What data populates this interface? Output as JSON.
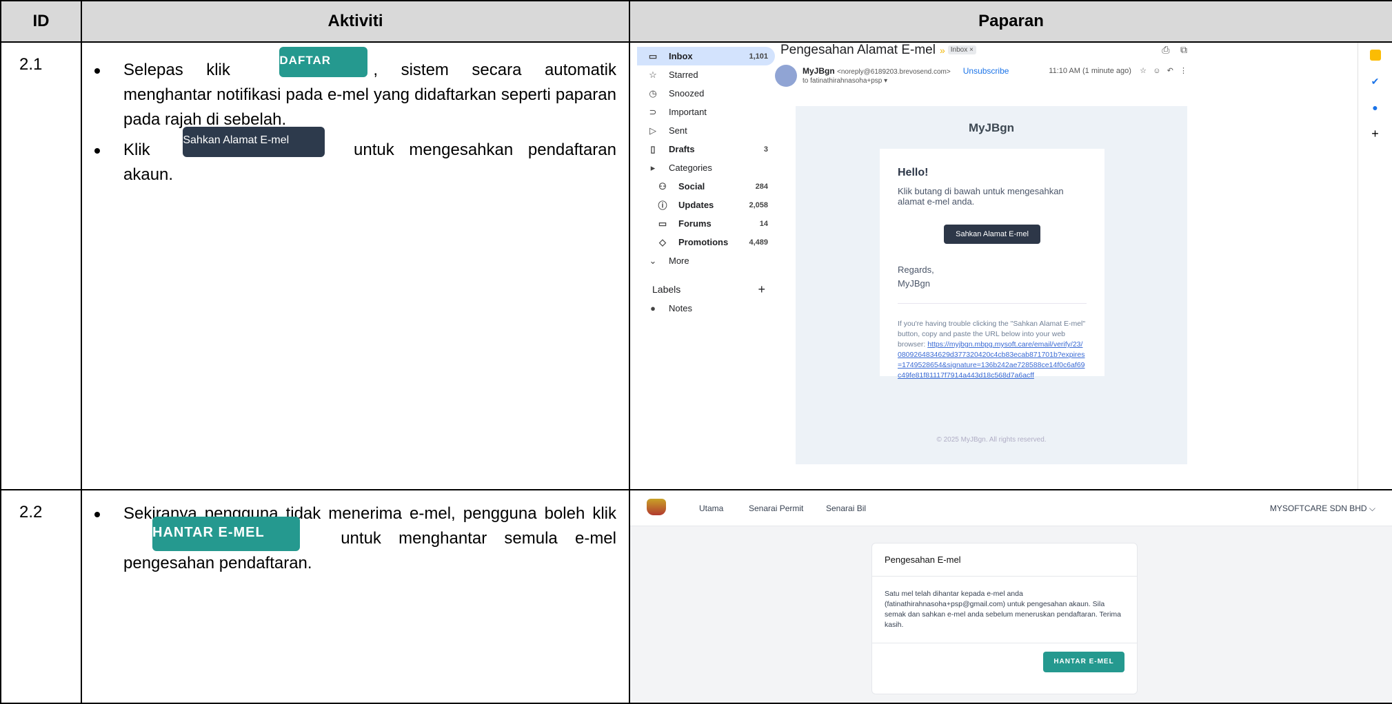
{
  "header": {
    "id": "ID",
    "activity": "Aktiviti",
    "display": "Paparan"
  },
  "rows": [
    {
      "id": "2.1",
      "bullet1_pre": "Selepas klik",
      "daftar_button": "DAFTAR",
      "bullet1_post": ", sistem secara automatik menghantar notifikasi pada e-mel yang didaftarkan seperti paparan pada rajah di sebelah.",
      "bullet2_pre": "Klik",
      "sahkan_button": "Sahkan Alamat E-mel",
      "bullet2_post": " untuk mengesahkan pendaftaran akaun."
    },
    {
      "id": "2.2",
      "bullet1_pre": "Sekiranya pengguna tidak menerima e-mel, pengguna boleh klik",
      "hantar_button": "HANTAR E-MEL",
      "bullet1_post": " untuk menghantar semula e-mel pengesahan pendaftaran."
    }
  ],
  "gmail": {
    "sidebar": [
      {
        "icon": "▭",
        "label": "Inbox",
        "count": "1,101",
        "selected": true
      },
      {
        "icon": "☆",
        "label": "Starred",
        "count": ""
      },
      {
        "icon": "◷",
        "label": "Snoozed",
        "count": ""
      },
      {
        "icon": "⊃",
        "label": "Important",
        "count": ""
      },
      {
        "icon": "▷",
        "label": "Sent",
        "count": ""
      },
      {
        "icon": "▯",
        "label": "Drafts",
        "count": "3"
      },
      {
        "icon": "▸",
        "label": "Categories",
        "count": ""
      },
      {
        "icon": "⚇",
        "label": "Social",
        "count": "284"
      },
      {
        "icon": "ⓘ",
        "label": "Updates",
        "count": "2,058"
      },
      {
        "icon": "▭",
        "label": "Forums",
        "count": "14"
      },
      {
        "icon": "◇",
        "label": "Promotions",
        "count": "4,489"
      },
      {
        "icon": "⌄",
        "label": "More",
        "count": ""
      }
    ],
    "labels_heading": "Labels",
    "labels_add": "+",
    "notes_label": "Notes",
    "subject": "Pengesahan Alamat E-mel",
    "inbox_tag": "Inbox ×",
    "sender_name": "MyJBgn",
    "sender_addr": "<noreply@6189203.brevosend.com>",
    "unsubscribe": "Unsubscribe",
    "to": "to fatinathirahnasoha+psp ▾",
    "time": "11:10 AM (1 minute ago)",
    "brand": "MyJBgn",
    "hello": "Hello!",
    "message": "Klik butang di bawah untuk mengesahkan alamat e-mel anda.",
    "button": "Sahkan Alamat E-mel",
    "regards": "Regards,",
    "signoff": "MyJBgn",
    "trouble": "If you're having trouble clicking the \"Sahkan Alamat E-mel\" button, copy and paste the URL below into your web browser: ",
    "url": "https://myjbgn.mbpg.mysoft.care/email/verify/23/0809264834629d377320420c4cb83ecab871701b?expires=1749528654&signature=136b242ae728588ce14f0c6af69c49fe81f81117f7914a443d18c568d7a6acff",
    "footer": "© 2025 MyJBgn. All rights reserved."
  },
  "web": {
    "nav": [
      "Utama",
      "Senarai Permit",
      "Senarai Bil"
    ],
    "company": "MYSOFTCARE SDN BHD ⌵",
    "card_title": "Pengesahan E-mel",
    "card_body": "Satu mel telah dihantar kepada e-mel anda (fatinathirahnasoha+psp@gmail.com) untuk pengesahan akaun. Sila semak dan sahkan e-mel anda sebelum meneruskan pendaftaran. Terima kasih.",
    "card_button": "HANTAR E-MEL"
  }
}
